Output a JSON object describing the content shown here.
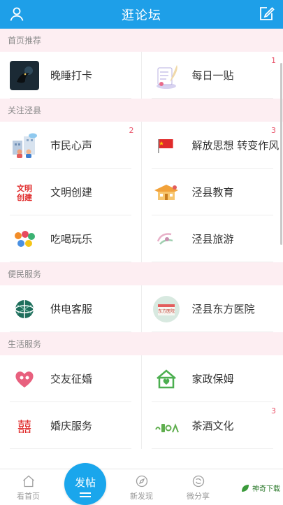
{
  "header": {
    "title": "逛论坛",
    "left_icon": "user-icon",
    "right_icon": "edit-icon"
  },
  "sections": [
    {
      "title": "首页推荐",
      "items": [
        {
          "label": "晚睡打卡",
          "badge": "",
          "icon": "night-bird-icon"
        },
        {
          "label": "每日一贴",
          "badge": "1",
          "icon": "quill-paper-icon"
        }
      ]
    },
    {
      "title": "关注泾县",
      "items": [
        {
          "label": "市民心声",
          "badge": "2",
          "icon": "city-people-icon"
        },
        {
          "label": "解放思想 转变作风",
          "badge": "3",
          "icon": "red-flag-icon"
        },
        {
          "label": "文明创建",
          "badge": "",
          "icon": "civilization-logo-icon",
          "icon_text": "文明\n创建"
        },
        {
          "label": "泾县教育",
          "badge": "",
          "icon": "education-icon"
        },
        {
          "label": "吃喝玩乐",
          "badge": "",
          "icon": "food-fun-icon"
        },
        {
          "label": "泾县旅游",
          "badge": "",
          "icon": "travel-icon"
        }
      ]
    },
    {
      "title": "便民服务",
      "items": [
        {
          "label": "供电客服",
          "badge": "",
          "icon": "power-grid-icon"
        },
        {
          "label": "泾县东方医院",
          "badge": "",
          "icon": "hospital-icon",
          "icon_text": "东方医院"
        }
      ]
    },
    {
      "title": "生活服务",
      "items": [
        {
          "label": "交友征婚",
          "badge": "",
          "icon": "heart-couple-icon"
        },
        {
          "label": "家政保姆",
          "badge": "",
          "icon": "house-heart-icon"
        },
        {
          "label": "婚庆服务",
          "badge": "",
          "icon": "double-happiness-icon",
          "icon_text": "囍"
        },
        {
          "label": "茶酒文化",
          "badge": "3",
          "icon": "tea-wine-icon"
        }
      ]
    }
  ],
  "tabbar": {
    "tabs": [
      {
        "label": "看首页",
        "icon": "home-icon"
      },
      {
        "label": "发帖",
        "icon": "post-plus-icon"
      },
      {
        "label": "新发现",
        "icon": "compass-icon"
      },
      {
        "label": "微分享",
        "icon": "share-icon"
      }
    ]
  },
  "watermark": "神奇下载",
  "colors": {
    "primary": "#1e9fe8",
    "section_bg": "#fdeef2",
    "badge": "#e9546b"
  }
}
